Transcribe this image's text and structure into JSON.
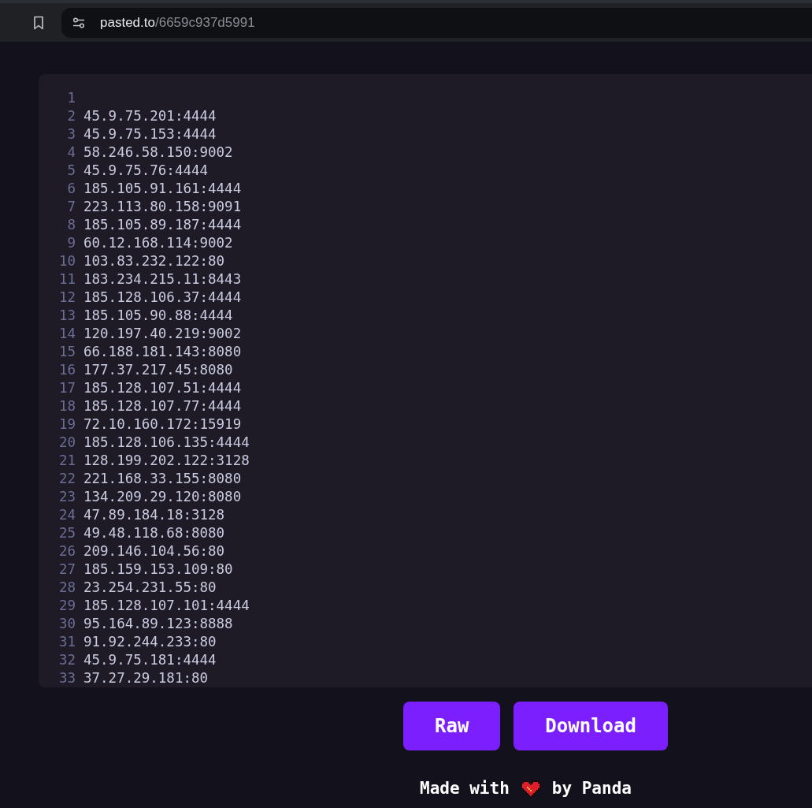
{
  "browser": {
    "url_host": "pasted.to",
    "url_path": "/6659c937d5991"
  },
  "lines": [
    {
      "number": "1"
    },
    {
      "number": "2",
      "text": "45.9.75.201:4444"
    },
    {
      "number": "3",
      "text": "45.9.75.153:4444"
    },
    {
      "number": "4",
      "text": "58.246.58.150:9002"
    },
    {
      "number": "5",
      "text": "45.9.75.76:4444"
    },
    {
      "number": "6",
      "text": "185.105.91.161:4444"
    },
    {
      "number": "7",
      "text": "223.113.80.158:9091"
    },
    {
      "number": "8",
      "text": "185.105.89.187:4444"
    },
    {
      "number": "9",
      "text": "60.12.168.114:9002"
    },
    {
      "number": "10",
      "text": "103.83.232.122:80"
    },
    {
      "number": "11",
      "text": "183.234.215.11:8443"
    },
    {
      "number": "12",
      "text": "185.128.106.37:4444"
    },
    {
      "number": "13",
      "text": "185.105.90.88:4444"
    },
    {
      "number": "14",
      "text": "120.197.40.219:9002"
    },
    {
      "number": "15",
      "text": "66.188.181.143:8080"
    },
    {
      "number": "16",
      "text": "177.37.217.45:8080"
    },
    {
      "number": "17",
      "text": "185.128.107.51:4444"
    },
    {
      "number": "18",
      "text": "185.128.107.77:4444"
    },
    {
      "number": "19",
      "text": "72.10.160.172:15919"
    },
    {
      "number": "20",
      "text": "185.128.106.135:4444"
    },
    {
      "number": "21",
      "text": "128.199.202.122:3128"
    },
    {
      "number": "22",
      "text": "221.168.33.155:8080"
    },
    {
      "number": "23",
      "text": "134.209.29.120:8080"
    },
    {
      "number": "24",
      "text": "47.89.184.18:3128"
    },
    {
      "number": "25",
      "text": "49.48.118.68:8080"
    },
    {
      "number": "26",
      "text": "209.146.104.56:80"
    },
    {
      "number": "27",
      "text": "185.159.153.109:80"
    },
    {
      "number": "28",
      "text": "23.254.231.55:80"
    },
    {
      "number": "29",
      "text": "185.128.107.101:4444"
    },
    {
      "number": "30",
      "text": "95.164.89.123:8888"
    },
    {
      "number": "31",
      "text": "91.92.244.233:80"
    },
    {
      "number": "32",
      "text": "45.9.75.181:4444"
    },
    {
      "number": "33",
      "text": "37.27.29.181:80"
    }
  ],
  "buttons": [
    "Raw",
    "Download"
  ],
  "footer": {
    "before": "Made with",
    "after": "by Panda"
  }
}
